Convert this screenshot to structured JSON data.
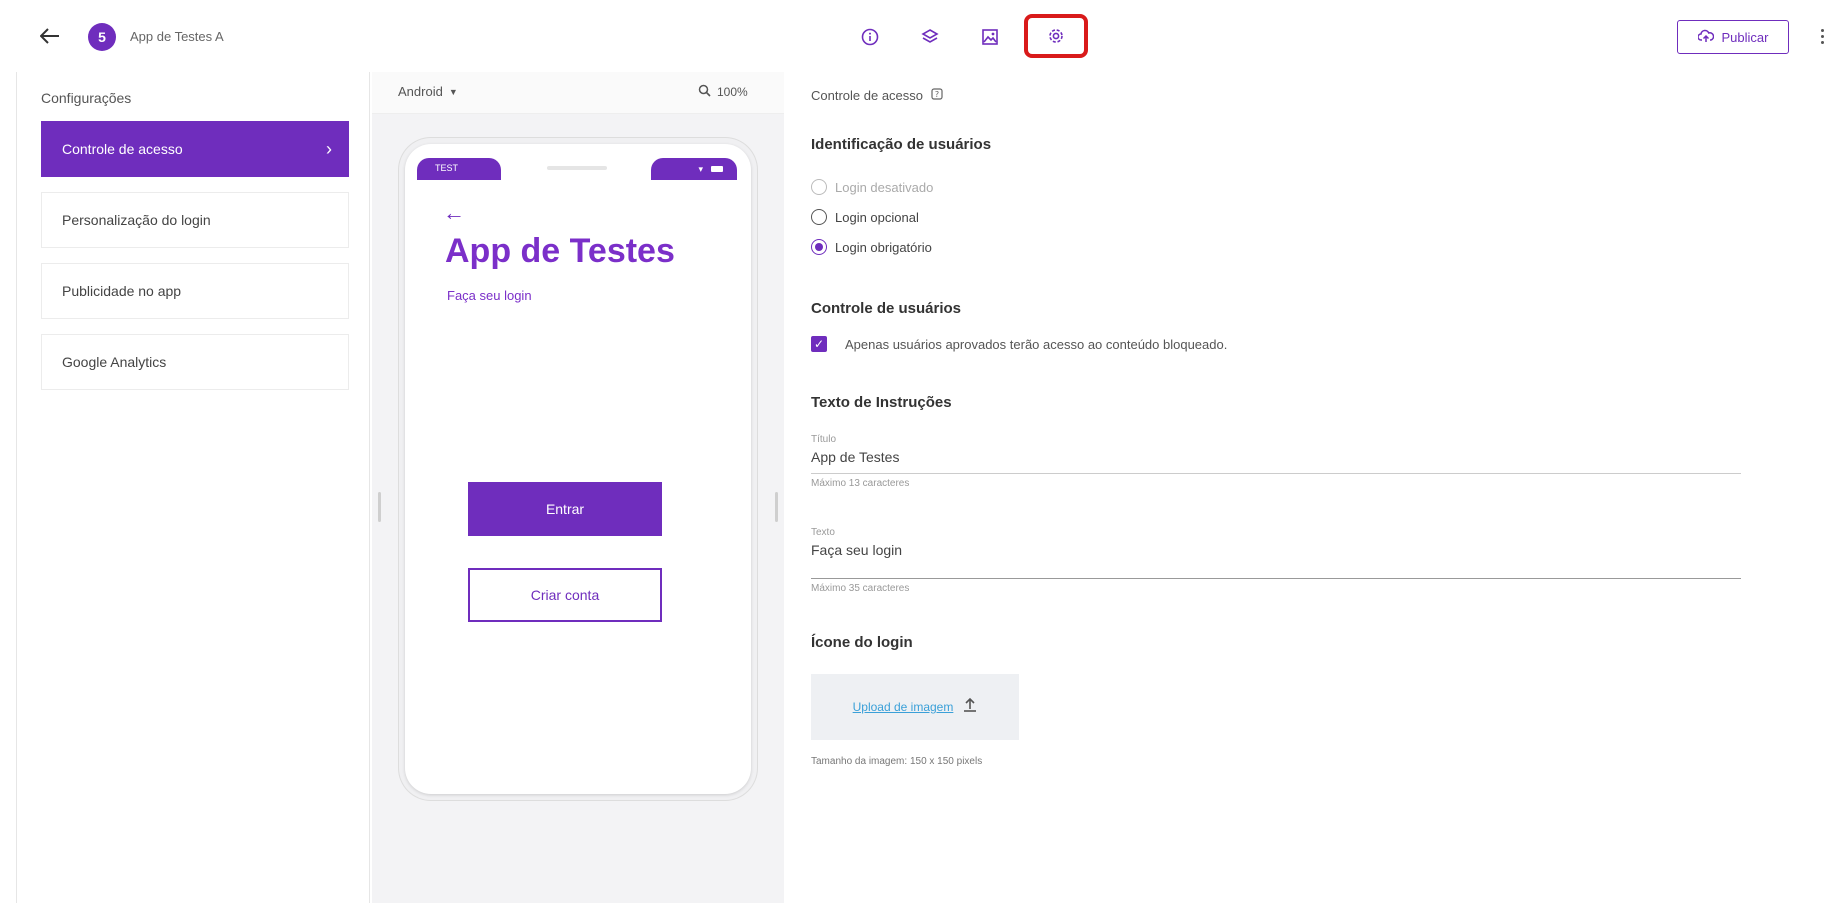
{
  "header": {
    "app_logo_letter": "5",
    "app_name": "App de Testes A",
    "publish_label": "Publicar",
    "icons": [
      "info-icon",
      "layers-icon",
      "image-icon",
      "settings-icon"
    ]
  },
  "sidebar": {
    "title": "Configurações",
    "items": [
      {
        "label": "Controle de acesso",
        "active": true
      },
      {
        "label": "Personalização do login",
        "active": false
      },
      {
        "label": "Publicidade no app",
        "active": false
      },
      {
        "label": "Google Analytics",
        "active": false
      }
    ]
  },
  "preview": {
    "platform": "Android",
    "zoom": "100%",
    "status_left": "TEST",
    "app_title": "App de Testes",
    "subtitle": "Faça seu login",
    "primary_button": "Entrar",
    "secondary_button": "Criar conta"
  },
  "panel": {
    "header": "Controle de acesso",
    "identification_title": "Identificação de usuários",
    "radio_options": [
      "Login desativado",
      "Login opcional",
      "Login obrigatório"
    ],
    "selected_option": "Login obrigatório",
    "users_control_title": "Controle de usuários",
    "approved_only_text": "Apenas usuários aprovados terão acesso ao conteúdo bloqueado.",
    "instructions_title": "Texto de Instruções",
    "title_field_label": "Título",
    "title_field_value": "App de Testes",
    "title_field_help": "Máximo 13 caracteres",
    "text_field_label": "Texto",
    "text_field_value": "Faça seu login",
    "text_field_help": "Máximo 35 caracteres",
    "login_icon_title": "Ícone do login",
    "upload_label": "Upload de imagem",
    "upload_help": "Tamanho da imagem: 150 x 150 pixels"
  },
  "colors": {
    "brand": "#6f2dbd",
    "annotation": "#d91a1a",
    "link": "#3aa0d8"
  }
}
